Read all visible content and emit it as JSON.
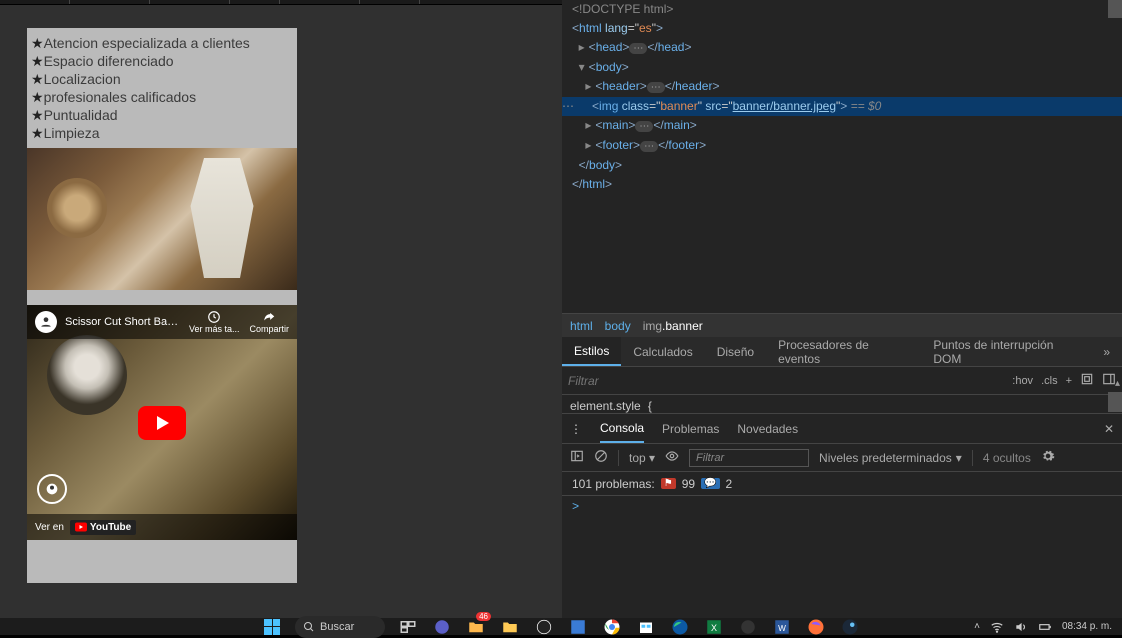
{
  "page": {
    "list": [
      "Atencion especializada a clientes",
      "Espacio diferenciado",
      "Localizacion",
      "profesionales calificados",
      "Puntualidad",
      "Limpieza"
    ],
    "video_title": "Scissor Cut Short Back and Sides ...",
    "watch_later": "Ver más ta...",
    "share": "Compartir",
    "watch_on": "Ver en",
    "youtube": "YouTube"
  },
  "dom": {
    "doctype": "<!DOCTYPE html>",
    "html_lang": "es",
    "head": "head",
    "body": "body",
    "header": "header",
    "img_class": "banner",
    "img_src": "banner/banner.jpeg",
    "eqvar": "== $0",
    "main": "main",
    "footer": "footer"
  },
  "crumbs": {
    "c1": "html",
    "c2": "body",
    "c3a": "img",
    "c3b": ".banner"
  },
  "styles": {
    "tabs": {
      "estilos": "Estilos",
      "calculados": "Calculados",
      "diseno": "Diseño",
      "procesadores": "Procesadores de eventos",
      "puntos": "Puntos de interrupción DOM"
    },
    "filter": "Filtrar",
    "hov": ":hov",
    "cls": ".cls",
    "rule": "element.style",
    "brace": "{"
  },
  "drawer": {
    "menu": "⋮",
    "tabs": {
      "consola": "Consola",
      "problemas": "Problemas",
      "novedades": "Novedades"
    },
    "top": "top",
    "filter": "Filtrar",
    "levels": "Niveles predeterminados",
    "hidden": "4 ocultos",
    "problems_label": "101 problemas:",
    "err": "99",
    "info": "2",
    "prompt": ">"
  },
  "taskbar": {
    "search": "Buscar",
    "badge": "46",
    "time": "08:34 p. m."
  }
}
